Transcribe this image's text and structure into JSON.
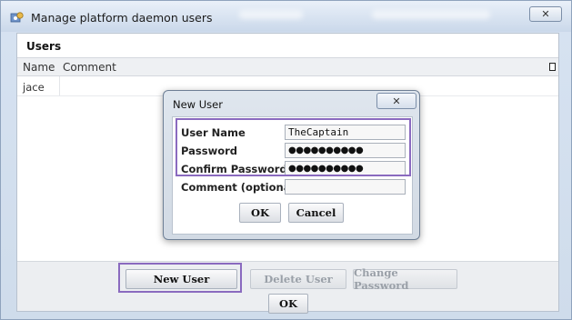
{
  "window": {
    "title": "Manage platform daemon users",
    "close_glyph": "✕"
  },
  "users_panel": {
    "heading": "Users",
    "columns": [
      "Name",
      "Comment"
    ],
    "rows": [
      {
        "name": "jace",
        "comment": ""
      }
    ]
  },
  "buttons": {
    "new_user": "New User",
    "delete_user": "Delete User",
    "change_password": "Change Password",
    "ok": "OK"
  },
  "new_user_dialog": {
    "title": "New User",
    "close_glyph": "✕",
    "fields": {
      "user_name": {
        "label": "User Name",
        "value": "TheCaptain"
      },
      "password": {
        "label": "Password",
        "value": "●●●●●●●●●●"
      },
      "confirm_password": {
        "label": "Confirm Password",
        "value": "●●●●●●●●●●"
      },
      "comment": {
        "label": "Comment (optional)",
        "value": ""
      }
    },
    "ok": "OK",
    "cancel": "Cancel"
  },
  "colors": {
    "highlight": "#8a6abf",
    "window_bg": "#d6e2f1"
  },
  "icons": {
    "app": "users-gear-icon",
    "column_picker": "column-chooser-icon"
  }
}
